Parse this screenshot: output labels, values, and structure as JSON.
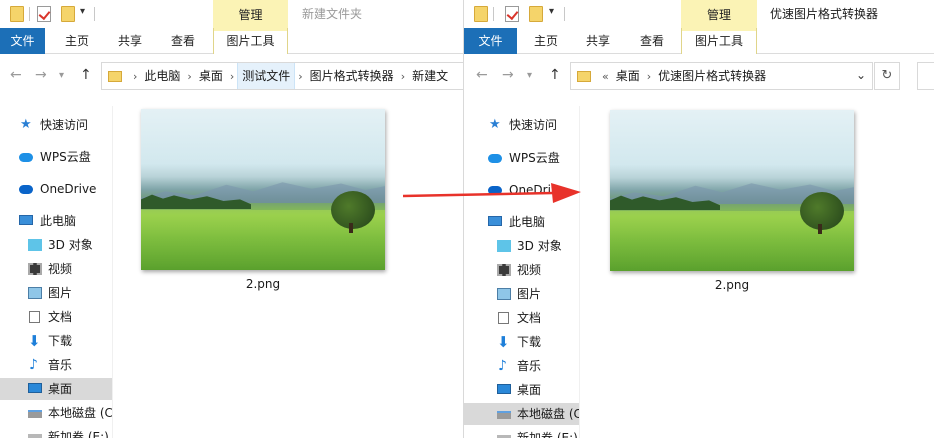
{
  "colors": {
    "accent": "#1c6fb7",
    "manage_tab": "#fbf3b5",
    "selected": "#cce8ff",
    "arrow": "#e8322a"
  },
  "icons": {
    "quick_access": "star-icon",
    "wps_cloud": "cloud-icon",
    "onedrive": "onedrive-icon",
    "this_pc": "computer-icon",
    "objects_3d": "cube-icon",
    "videos": "film-icon",
    "pictures": "picture-icon",
    "documents": "document-icon",
    "downloads": "download-icon",
    "music": "music-icon",
    "desktop": "desktop-icon",
    "local_disk": "drive-icon",
    "new_volume": "drive-icon"
  },
  "left": {
    "title": "新建文件夹",
    "manage_label": "管理",
    "ribbon": {
      "file": "文件",
      "home": "主页",
      "share": "共享",
      "view": "查看",
      "picture_tools": "图片工具"
    },
    "breadcrumbs": [
      "此电脑",
      "桌面",
      "测试文件",
      "图片格式转换器",
      "新建文"
    ],
    "sidebar": [
      {
        "label": "快速访问"
      },
      {
        "label": "WPS云盘"
      },
      {
        "label": "OneDrive"
      },
      {
        "label": "此电脑"
      },
      {
        "label": "3D 对象"
      },
      {
        "label": "视频"
      },
      {
        "label": "图片"
      },
      {
        "label": "文档"
      },
      {
        "label": "下载"
      },
      {
        "label": "音乐"
      },
      {
        "label": "桌面"
      },
      {
        "label": "本地磁盘 (C"
      },
      {
        "label": "新加卷 (E:)"
      }
    ],
    "file": {
      "name": "2.png"
    }
  },
  "right": {
    "title": "优速图片格式转换器",
    "manage_label": "管理",
    "ribbon": {
      "file": "文件",
      "home": "主页",
      "share": "共享",
      "view": "查看",
      "picture_tools": "图片工具"
    },
    "breadcrumb_prefix": "«",
    "breadcrumbs": [
      "桌面",
      "优速图片格式转换器"
    ],
    "sidebar": [
      {
        "label": "快速访问"
      },
      {
        "label": "WPS云盘"
      },
      {
        "label": "OneDrive"
      },
      {
        "label": "此电脑"
      },
      {
        "label": "3D 对象"
      },
      {
        "label": "视频"
      },
      {
        "label": "图片"
      },
      {
        "label": "文档"
      },
      {
        "label": "下载"
      },
      {
        "label": "音乐"
      },
      {
        "label": "桌面"
      },
      {
        "label": "本地磁盘 (C"
      },
      {
        "label": "新加卷 (E:)"
      }
    ],
    "file": {
      "name": "2.png"
    }
  }
}
